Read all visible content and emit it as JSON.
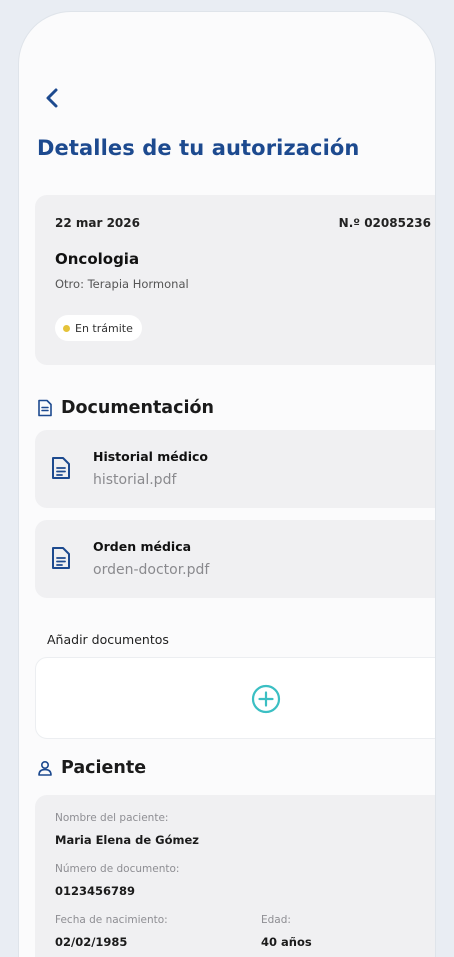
{
  "header": {
    "back_icon": "chevron-left-icon",
    "title": "Detalles de tu autorización"
  },
  "authorization": {
    "date": "22 mar 2026",
    "number": "N.º 02085236",
    "specialty": "Oncologia",
    "subtitle": "Otro: Terapia Hormonal",
    "status": "En trámite",
    "status_color": "#e5c33a"
  },
  "documentation": {
    "icon": "document-icon",
    "title": "Documentación",
    "documents": [
      {
        "title": "Historial médico",
        "file": "historial.pdf",
        "icon": "file-icon"
      },
      {
        "title": "Orden médica",
        "file": "orden-doctor.pdf",
        "icon": "file-icon"
      }
    ],
    "add_label": "Añadir documentos",
    "add_icon": "plus-circle-icon"
  },
  "patient": {
    "icon": "user-icon",
    "title": "Paciente",
    "name_label": "Nombre del paciente:",
    "name": "Maria Elena de Gómez",
    "doc_label": "Número de documento:",
    "doc_number": "0123456789",
    "birth_label": "Fecha de nacimiento:",
    "birth_date": "02/02/1985",
    "age_label": "Edad:",
    "age": "40 años"
  },
  "colors": {
    "accent": "#1d4a8f",
    "add_accent": "#3bbfc3",
    "background": "#e9edf3",
    "card": "#f0f0f2"
  }
}
